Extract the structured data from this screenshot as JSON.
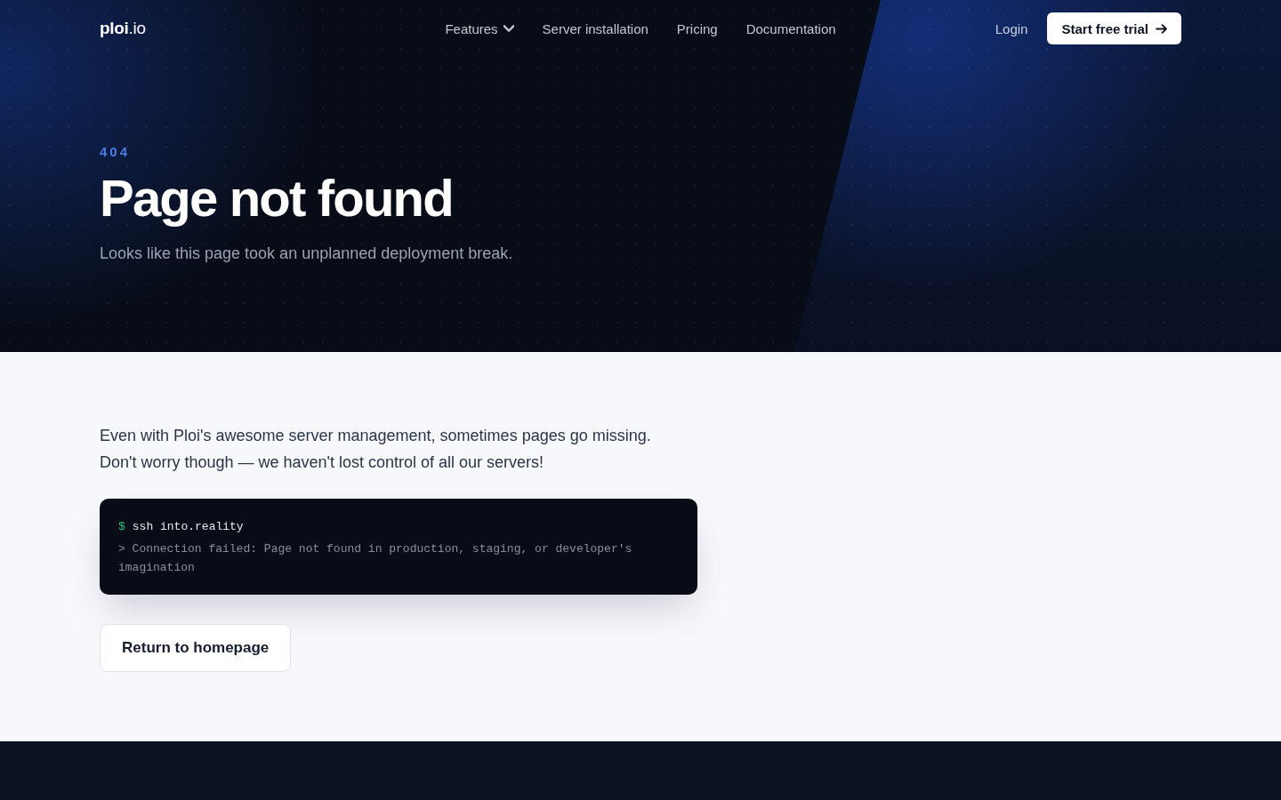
{
  "header": {
    "logo": {
      "name": "ploi",
      "suffix": ".io"
    },
    "nav": [
      {
        "label": "Features",
        "kind": "dropdown"
      },
      {
        "label": "Server installation",
        "kind": "link"
      },
      {
        "label": "Pricing",
        "kind": "link"
      },
      {
        "label": "Documentation",
        "kind": "link"
      }
    ],
    "login": "Login",
    "cta": "Start free trial"
  },
  "hero": {
    "code": "404",
    "title": "Page not found",
    "subtitle": "Looks like this page took an unplanned deployment break."
  },
  "content": {
    "intro": [
      "Even with Ploi's awesome server management, sometimes pages go missing.",
      "Don't worry though — we haven't lost control of all our servers!"
    ],
    "terminal": {
      "prompt": "$",
      "command": "ssh into.reality",
      "output": "> Connection failed: Page not found in production, staging, or developer's imagination"
    },
    "button": "Return to homepage"
  }
}
